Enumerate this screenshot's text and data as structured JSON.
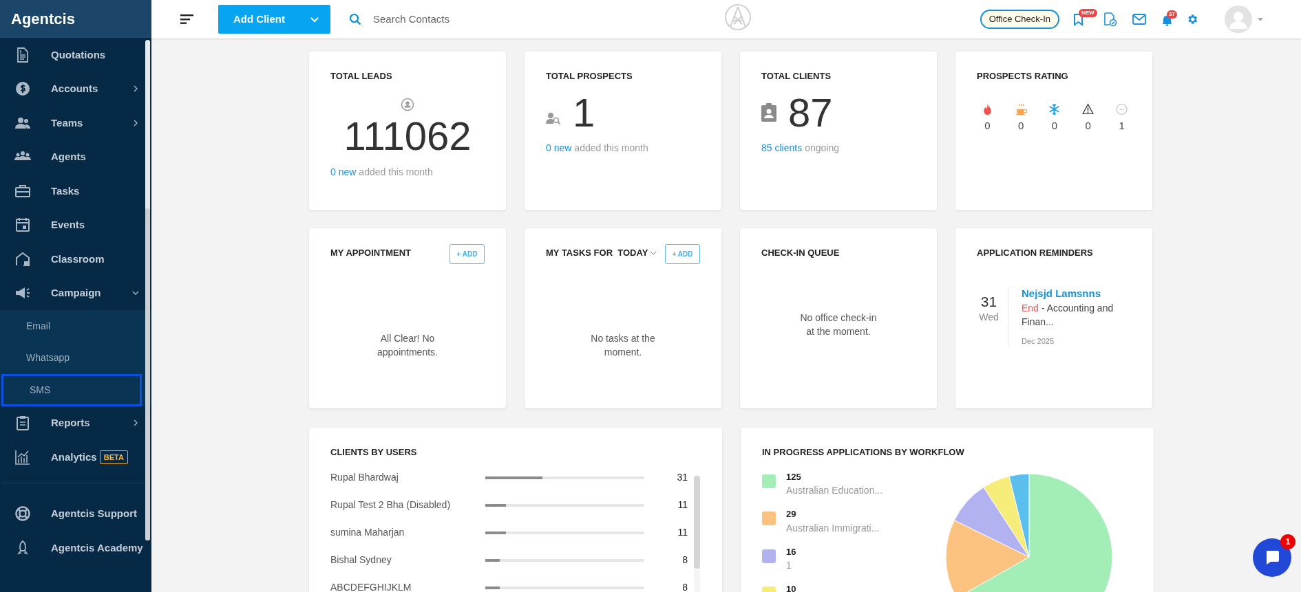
{
  "sidebar": {
    "brand": "Agentcis",
    "items": [
      {
        "label": "Quotations",
        "kind": "document"
      },
      {
        "label": "Accounts",
        "kind": "dollar",
        "expandable": true,
        "expanded": false
      },
      {
        "label": "Teams",
        "kind": "team",
        "expandable": true,
        "expanded": false
      },
      {
        "label": "Agents",
        "kind": "agents"
      },
      {
        "label": "Tasks",
        "kind": "briefcase"
      },
      {
        "label": "Events",
        "kind": "calendar"
      },
      {
        "label": "Classroom",
        "kind": "house"
      },
      {
        "label": "Campaign",
        "kind": "megaphone",
        "expandable": true,
        "expanded": true,
        "children": [
          {
            "label": "Email",
            "selected": false
          },
          {
            "label": "Whatsapp",
            "selected": false
          },
          {
            "label": "SMS",
            "selected": true
          }
        ]
      },
      {
        "label": "Reports",
        "kind": "clipboard",
        "expandable": true,
        "expanded": false
      },
      {
        "label": "Analytics",
        "kind": "chart",
        "badge": "BETA"
      }
    ],
    "footer_items": [
      {
        "label": "Agentcis Support",
        "kind": "lifebuoy"
      },
      {
        "label": "Agentcis Academy",
        "kind": "rocket"
      }
    ]
  },
  "topbar": {
    "add_button": "Add Client",
    "search": {
      "placeholder": "Search Contacts"
    },
    "check_in_button": "Office Check-In",
    "bookmark_badge": "NEW",
    "notification_count": "37"
  },
  "stats": [
    {
      "kind": "leads",
      "title": "TOTAL LEADS",
      "value": "111062",
      "link": "0 new",
      "note": "added this month"
    },
    {
      "kind": "prospects",
      "title": "TOTAL PROSPECTS",
      "value": "1",
      "link": "0 new",
      "note": "added this month"
    },
    {
      "kind": "clients",
      "title": "TOTAL CLIENTS",
      "value": "87",
      "link": "85 clients",
      "note": "ongoing"
    }
  ],
  "prospects_rating": {
    "title": "PROSPECTS RATING",
    "items": [
      {
        "kind": "fire",
        "count": "0",
        "color": "#ef5350"
      },
      {
        "kind": "coffee",
        "count": "0",
        "color": "#f6a550"
      },
      {
        "kind": "snowflake",
        "count": "0",
        "color": "#1ba4ea"
      },
      {
        "kind": "warning",
        "count": "0",
        "color": "#444444"
      },
      {
        "kind": "none",
        "count": "1",
        "color": "#cccccc"
      }
    ]
  },
  "appointment": {
    "title": "MY APPOINTMENT",
    "add": "+ ADD",
    "empty": "All Clear! No appointments."
  },
  "tasks": {
    "title": "MY TASKS FOR  TODAY",
    "add": "+ ADD",
    "empty": "No tasks at the moment."
  },
  "check_in_queue": {
    "title": "CHECK-IN QUEUE",
    "empty": "No office check-in at the moment."
  },
  "reminders": {
    "title": "APPLICATION REMINDERS",
    "items": [
      {
        "day": "31",
        "weekday": "Wed",
        "name": "Nejsjd Lamsnns",
        "status": "End",
        "detail": "- Accounting and Finan...",
        "month": "Dec 2025"
      }
    ]
  },
  "clients_by_users": {
    "title": "CLIENTS BY USERS",
    "rows": [
      {
        "name": "Rupal Bhardwaj",
        "level": 0.36,
        "count": "31"
      },
      {
        "name": "Rupal Test 2 Bha (Disabled)",
        "level": 0.13,
        "count": "11"
      },
      {
        "name": "sumina Maharjan",
        "level": 0.13,
        "count": "11"
      },
      {
        "name": "Bishal Sydney",
        "level": 0.09,
        "count": "8"
      },
      {
        "name": "ABCDEFGHIJKLM",
        "level": 0.09,
        "count": "8"
      }
    ]
  },
  "workflow": {
    "title": "IN PROGRESS APPLICATIONS BY WORKFLOW",
    "legend": [
      {
        "count": "125",
        "label": "Australian Education...",
        "color": "#a3eeb6"
      },
      {
        "count": "29",
        "label": "Australian Immigrati...",
        "color": "#fcc27f"
      },
      {
        "count": "16",
        "label": "1",
        "color": "#b3b2f1"
      },
      {
        "count": "10",
        "color": "#f6ec7a"
      }
    ]
  },
  "chat": {
    "badge": "1"
  }
}
